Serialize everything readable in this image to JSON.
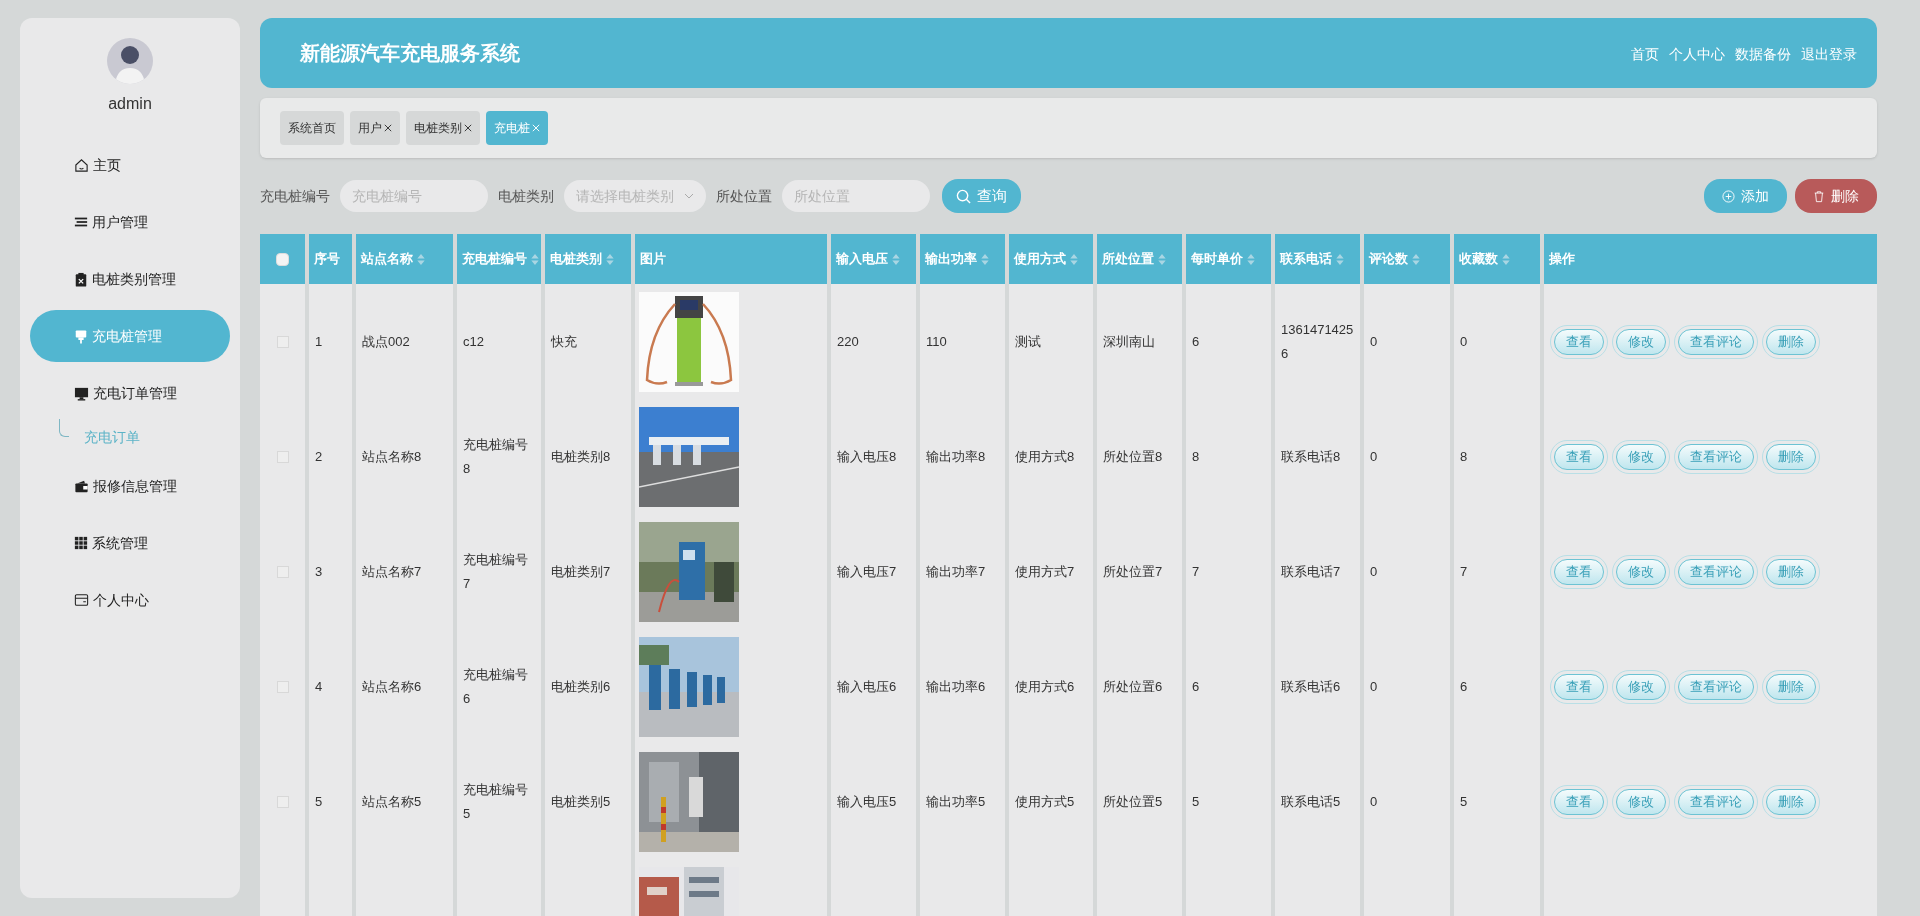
{
  "sidebar": {
    "user": "admin",
    "menu": [
      {
        "label": "主页",
        "selected": false
      },
      {
        "label": "用户管理",
        "selected": false
      },
      {
        "label": "电桩类别管理",
        "selected": false
      },
      {
        "label": "充电桩管理",
        "selected": true
      },
      {
        "label": "充电订单管理",
        "selected": false,
        "children": [
          {
            "label": "充电订单",
            "selected": false
          }
        ]
      },
      {
        "label": "报修信息管理",
        "selected": false
      },
      {
        "label": "系统管理",
        "selected": false
      },
      {
        "label": "个人中心",
        "selected": false
      }
    ]
  },
  "header": {
    "title": "新能源汽车充电服务系统",
    "links": [
      "首页",
      "个人中心",
      "数据备份",
      "退出登录"
    ]
  },
  "tabs": [
    {
      "label": "系统首页",
      "closable": false,
      "selected": false
    },
    {
      "label": "用户",
      "closable": true,
      "selected": false
    },
    {
      "label": "电桩类别",
      "closable": true,
      "selected": false
    },
    {
      "label": "充电桩",
      "closable": true,
      "selected": true
    }
  ],
  "filters": [
    {
      "label": "充电桩编号",
      "kind": "input",
      "placeholder": "充电桩编号"
    },
    {
      "label": "电桩类别",
      "kind": "select",
      "placeholder": "请选择电桩类别"
    },
    {
      "label": "所处位置",
      "kind": "input",
      "placeholder": "所处位置"
    }
  ],
  "search_button": "查询",
  "actions": [
    {
      "label": "添加",
      "kind": "add"
    },
    {
      "label": "删除",
      "kind": "delete"
    }
  ],
  "table": {
    "select_all": {
      "checked": false
    },
    "columns": [
      {
        "label": "序号",
        "sortable": false
      },
      {
        "label": "站点名称",
        "sortable": true
      },
      {
        "label": "充电桩编号",
        "sortable": true
      },
      {
        "label": "电桩类别",
        "sortable": true
      },
      {
        "label": "图片",
        "sortable": false
      },
      {
        "label": "输入电压",
        "sortable": true
      },
      {
        "label": "输出功率",
        "sortable": true
      },
      {
        "label": "使用方式",
        "sortable": true
      },
      {
        "label": "所处位置",
        "sortable": true
      },
      {
        "label": "每时单价",
        "sortable": true
      },
      {
        "label": "联系电话",
        "sortable": true
      },
      {
        "label": "评论数",
        "sortable": true
      },
      {
        "label": "收藏数",
        "sortable": true
      },
      {
        "label": "操作",
        "sortable": false
      }
    ],
    "rows": [
      {
        "checked": false,
        "cells": [
          "1",
          "战点002",
          "c12",
          "快充",
          {
            "kind": "picture"
          },
          "220",
          "110",
          "测试",
          "深圳南山",
          "6",
          "13614714256",
          "0",
          "0"
        ],
        "actions": [
          "查看",
          "修改",
          "查看评论",
          "删除"
        ]
      },
      {
        "checked": false,
        "cells": [
          "2",
          "站点名称8",
          "充电桩编号8",
          "电桩类别8",
          {
            "kind": "picture"
          },
          "输入电压8",
          "输出功率8",
          "使用方式8",
          "所处位置8",
          "8",
          "联系电话8",
          "0",
          "8"
        ],
        "actions": [
          "查看",
          "修改",
          "查看评论",
          "删除"
        ]
      },
      {
        "checked": false,
        "cells": [
          "3",
          "站点名称7",
          "充电桩编号7",
          "电桩类别7",
          {
            "kind": "picture"
          },
          "输入电压7",
          "输出功率7",
          "使用方式7",
          "所处位置7",
          "7",
          "联系电话7",
          "0",
          "7"
        ],
        "actions": [
          "查看",
          "修改",
          "查看评论",
          "删除"
        ]
      },
      {
        "checked": false,
        "cells": [
          "4",
          "站点名称6",
          "充电桩编号6",
          "电桩类别6",
          {
            "kind": "picture"
          },
          "输入电压6",
          "输出功率6",
          "使用方式6",
          "所处位置6",
          "6",
          "联系电话6",
          "0",
          "6"
        ],
        "actions": [
          "查看",
          "修改",
          "查看评论",
          "删除"
        ]
      },
      {
        "checked": false,
        "cells": [
          "5",
          "站点名称5",
          "充电桩编号5",
          "电桩类别5",
          {
            "kind": "picture"
          },
          "输入电压5",
          "输出功率5",
          "使用方式5",
          "所处位置5",
          "5",
          "联系电话5",
          "0",
          "5"
        ],
        "actions": [
          "查看",
          "修改",
          "查看评论",
          "删除"
        ]
      }
    ],
    "partial_row": {
      "kind": "picture"
    }
  }
}
